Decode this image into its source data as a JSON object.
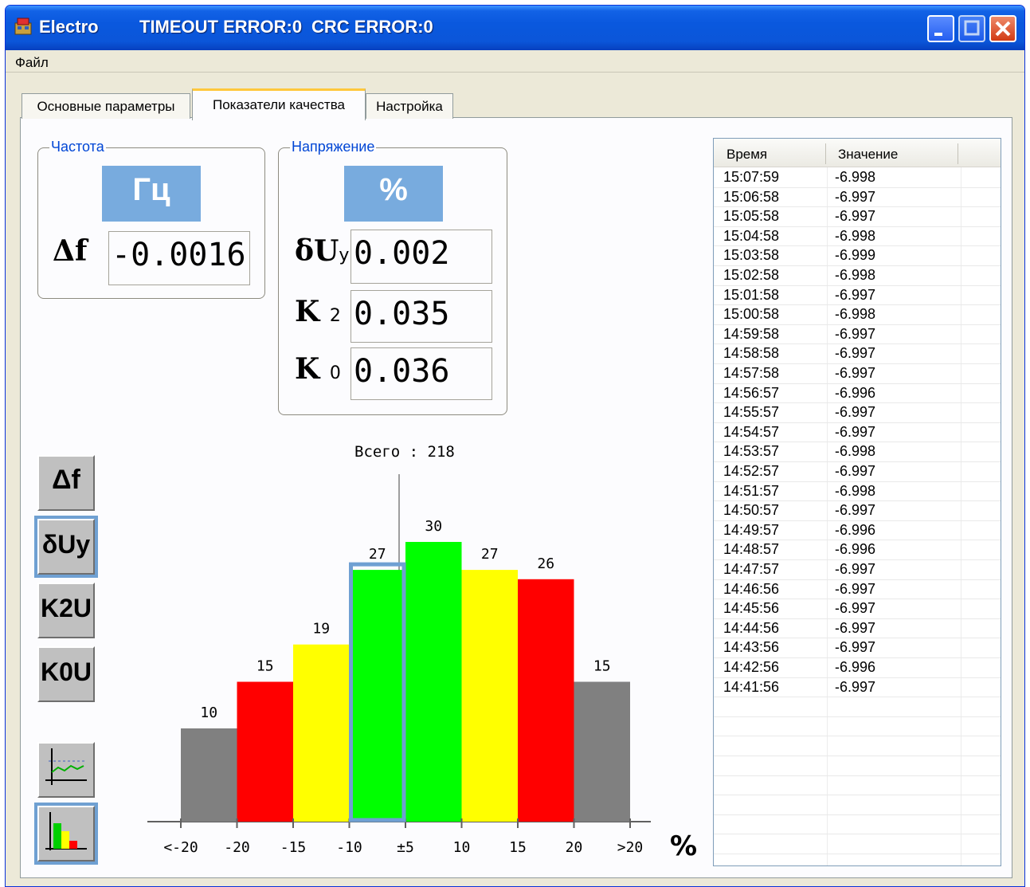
{
  "window": {
    "title": "Electro",
    "timeout_error": "TIMEOUT ERROR:0",
    "crc_error": "CRC ERROR:0"
  },
  "menu": {
    "file": "Файл"
  },
  "tabs": [
    {
      "label": "Основные параметры",
      "active": false
    },
    {
      "label": "Показатели качества",
      "active": true
    },
    {
      "label": "Настройка",
      "active": false
    }
  ],
  "frequency": {
    "group_label": "Частота",
    "unit": "Гц",
    "symbol": "Δf",
    "value": "-0.0016"
  },
  "voltage": {
    "group_label": "Напряжение",
    "unit": "%",
    "du_symbol": "δU",
    "du_sub": "y",
    "du_value": "0.002",
    "k2_symbol": "K",
    "k2_sub": "2",
    "k2_value": "0.035",
    "k0_symbol": "K",
    "k0_sub": "0",
    "k0_value": "0.036"
  },
  "side_buttons": {
    "df": "Δf",
    "du": "δUy",
    "k2": "K2U",
    "k0": "K0U",
    "trend_icon": "trend-chart-icon",
    "histogram_icon": "histogram-icon"
  },
  "chart_data": {
    "type": "bar",
    "title": "Всего :  218",
    "unit_label": "%",
    "categories": [
      "<-20",
      "-20",
      "-15",
      "-10",
      "±5",
      "10",
      "15",
      "20",
      ">20"
    ],
    "values": [
      10,
      15,
      19,
      27,
      30,
      27,
      26,
      15
    ],
    "bar_colors": [
      "#808080",
      "#ff0000",
      "#ffff00",
      "#00ff00",
      "#00ff00",
      "#ffff00",
      "#ff0000",
      "#808080"
    ],
    "highlight_index": 3,
    "highlight_color": "#6fa0d2",
    "ylim": [
      0,
      30
    ]
  },
  "table": {
    "col_time": "Время",
    "col_value": "Значение",
    "rows": [
      [
        "15:07:59",
        "-6.998"
      ],
      [
        "15:06:58",
        "-6.997"
      ],
      [
        "15:05:58",
        "-6.997"
      ],
      [
        "15:04:58",
        "-6.998"
      ],
      [
        "15:03:58",
        "-6.999"
      ],
      [
        "15:02:58",
        "-6.998"
      ],
      [
        "15:01:58",
        "-6.997"
      ],
      [
        "15:00:58",
        "-6.998"
      ],
      [
        "14:59:58",
        "-6.997"
      ],
      [
        "14:58:58",
        "-6.997"
      ],
      [
        "14:57:58",
        "-6.997"
      ],
      [
        "14:56:57",
        "-6.996"
      ],
      [
        "14:55:57",
        "-6.997"
      ],
      [
        "14:54:57",
        "-6.997"
      ],
      [
        "14:53:57",
        "-6.998"
      ],
      [
        "14:52:57",
        "-6.997"
      ],
      [
        "14:51:57",
        "-6.998"
      ],
      [
        "14:50:57",
        "-6.997"
      ],
      [
        "14:49:57",
        "-6.996"
      ],
      [
        "14:48:57",
        "-6.996"
      ],
      [
        "14:47:57",
        "-6.997"
      ],
      [
        "14:46:56",
        "-6.997"
      ],
      [
        "14:45:56",
        "-6.997"
      ],
      [
        "14:44:56",
        "-6.997"
      ],
      [
        "14:43:56",
        "-6.997"
      ],
      [
        "14:42:56",
        "-6.996"
      ],
      [
        "14:41:56",
        "-6.997"
      ]
    ]
  }
}
